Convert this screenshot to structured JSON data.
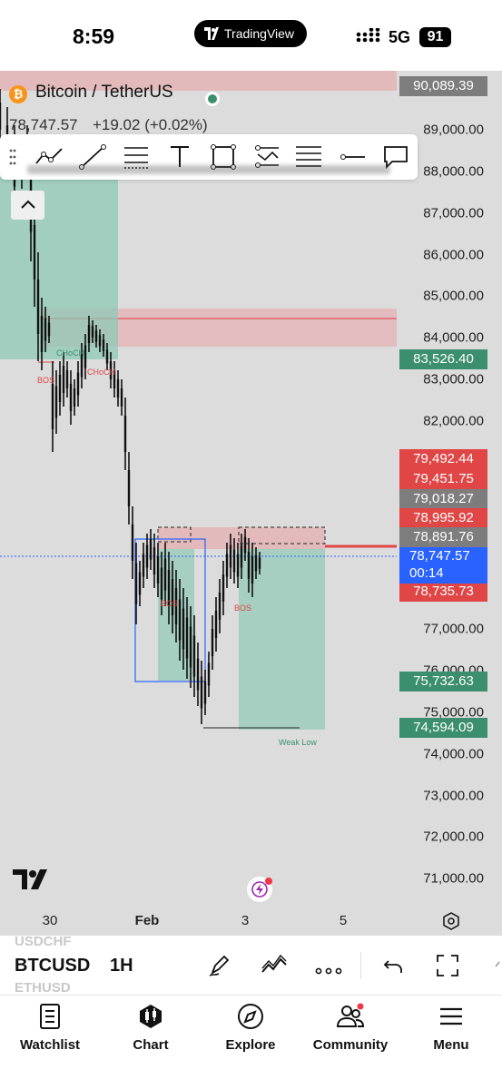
{
  "status_bar": {
    "time": "8:59",
    "app_pill": "TradingView",
    "network": "5G",
    "battery": "91"
  },
  "symbol": {
    "name": "Bitcoin / TetherUS",
    "last_price": "78,747.57",
    "change": "+19.02 (+0.02%)"
  },
  "price_ticks": [
    "89,000.00",
    "88,000.00",
    "87,000.00",
    "86,000.00",
    "85,000.00",
    "84,000.00",
    "83,000.00",
    "82,000.00",
    "77,000.00",
    "76,000.00",
    "75,000.00",
    "74,000.00",
    "73,000.00",
    "72,000.00",
    "71,000.00"
  ],
  "price_tags": [
    {
      "label": "90,089.39",
      "color": "#7d7d7d"
    },
    {
      "label": "83,526.40",
      "color": "#3b8f6e"
    },
    {
      "label": "79,492.44",
      "color": "#e04646"
    },
    {
      "label": "79,451.75",
      "color": "#e04646"
    },
    {
      "label": "79,018.27",
      "color": "#7d7d7d"
    },
    {
      "label": "78,995.92",
      "color": "#e04646"
    },
    {
      "label": "78,891.76",
      "color": "#7d7d7d"
    },
    {
      "label": "78,735.73",
      "color": "#e04646"
    },
    {
      "label": "75,732.63",
      "color": "#3b8f6e"
    },
    {
      "label": "74,594.09",
      "color": "#3b8f6e"
    }
  ],
  "current_tag": {
    "price": "78,747.57",
    "countdown": "00:14",
    "color": "#2962ff"
  },
  "time_ticks": [
    {
      "label": "30",
      "bold": false
    },
    {
      "label": "Feb",
      "bold": true
    },
    {
      "label": "3",
      "bold": false
    },
    {
      "label": "5",
      "bold": false
    }
  ],
  "annotations": {
    "choch_1": "CHoCH",
    "choch_2": "CHoCH",
    "bos_1": "BOS",
    "bos_2": "BOS",
    "bos_3": "BOS",
    "weak_low": "Weak Low"
  },
  "collapse_label": "^",
  "symbol_strip": {
    "symbol": "BTCUSD",
    "interval": "1H",
    "ghost_top": "USDCHF",
    "ghost_bottom": "ETHUSD"
  },
  "drawing_tools": [
    "trend-path-icon",
    "line-icon",
    "fib-icon",
    "text-icon",
    "rectangle-icon",
    "pattern-icon",
    "lines-icon",
    "horizontal-ray-icon",
    "callout-icon"
  ],
  "bottom_nav": [
    {
      "label": "Watchlist",
      "icon": "watchlist-icon"
    },
    {
      "label": "Chart",
      "icon": "chart-icon"
    },
    {
      "label": "Explore",
      "icon": "compass-icon"
    },
    {
      "label": "Community",
      "icon": "community-icon"
    },
    {
      "label": "Menu",
      "icon": "menu-icon"
    }
  ],
  "colors": {
    "zone_red": "#e8a8ab",
    "zone_teal": "#8ec9b6",
    "candle": "#111111",
    "bos_label": "#e04646",
    "choch_label": "#3b8f6e",
    "current_price_line": "#2962ff"
  }
}
